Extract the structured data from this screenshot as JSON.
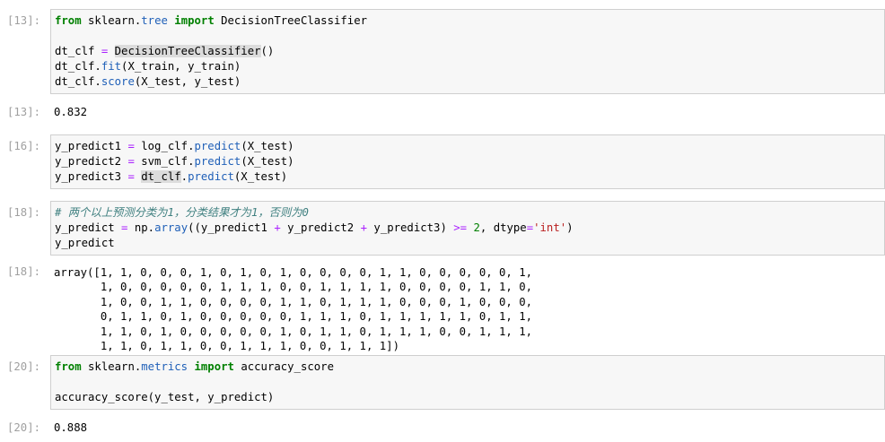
{
  "cells": [
    {
      "prompt": "[13]:",
      "lines": [
        [
          [
            "from",
            "kw"
          ],
          " sklearn.",
          [
            "tree",
            "attr"
          ],
          " ",
          [
            "import",
            "kw"
          ],
          " DecisionTreeClassifier"
        ],
        [],
        [
          "dt_clf ",
          [
            "=",
            "op"
          ],
          " ",
          [
            "DecisionTreeClassifier",
            "hl"
          ],
          "()"
        ],
        [
          "dt_clf.",
          [
            "fit",
            "attr"
          ],
          "(X_train, y_train)"
        ],
        [
          "dt_clf.",
          [
            "score",
            "attr"
          ],
          "(X_test, y_test)"
        ]
      ],
      "output_prompt": "[13]:",
      "output": "0.832"
    },
    {
      "prompt": "[16]:",
      "lines": [
        [
          "y_predict1 ",
          [
            "=",
            "op"
          ],
          " log_clf.",
          [
            "predict",
            "attr"
          ],
          "(X_test)"
        ],
        [
          "y_predict2 ",
          [
            "=",
            "op"
          ],
          " svm_clf.",
          [
            "predict",
            "attr"
          ],
          "(X_test)"
        ],
        [
          "y_predict3 ",
          [
            "=",
            "op"
          ],
          " ",
          [
            "dt_clf",
            "hl"
          ],
          ".",
          [
            "predict",
            "attr"
          ],
          "(X_test)"
        ]
      ]
    },
    {
      "prompt": "[18]:",
      "lines": [
        [
          [
            "# 两个以上预测分类为1，分类结果才为1，否则为0",
            "cm"
          ]
        ],
        [
          "y_predict ",
          [
            "=",
            "op"
          ],
          " np.",
          [
            "array",
            "attr"
          ],
          "((y_predict1 ",
          [
            "+",
            "op"
          ],
          " y_predict2 ",
          [
            "+",
            "op"
          ],
          " y_predict3) ",
          [
            ">=",
            "op"
          ],
          " ",
          [
            "2",
            "num"
          ],
          ", dtype",
          [
            "=",
            "op"
          ],
          [
            "'int'",
            "str"
          ],
          ")"
        ],
        [
          "y_predict"
        ]
      ],
      "output_prompt": "[18]:",
      "output": "array([1, 1, 0, 0, 0, 1, 0, 1, 0, 1, 0, 0, 0, 0, 1, 1, 0, 0, 0, 0, 0, 1,\n       1, 0, 0, 0, 0, 0, 1, 1, 1, 0, 0, 1, 1, 1, 1, 0, 0, 0, 0, 1, 1, 0,\n       1, 0, 0, 1, 1, 0, 0, 0, 0, 1, 1, 0, 1, 1, 1, 0, 0, 0, 1, 0, 0, 0,\n       0, 1, 1, 0, 1, 0, 0, 0, 0, 0, 1, 1, 1, 0, 1, 1, 1, 1, 1, 0, 1, 1,\n       1, 1, 0, 1, 0, 0, 0, 0, 0, 1, 0, 1, 1, 0, 1, 1, 1, 0, 0, 1, 1, 1,\n       1, 1, 0, 1, 1, 0, 0, 1, 1, 1, 0, 0, 1, 1, 1])"
    },
    {
      "prompt": "[20]:",
      "lines": [
        [
          [
            "from",
            "kw"
          ],
          " sklearn.",
          [
            "metrics",
            "attr"
          ],
          " ",
          [
            "import",
            "kw"
          ],
          " accuracy_score"
        ],
        [],
        [
          "accuracy_score(y_test, y_predict)"
        ]
      ],
      "output_prompt": "[20]:",
      "output": "0.888"
    }
  ]
}
